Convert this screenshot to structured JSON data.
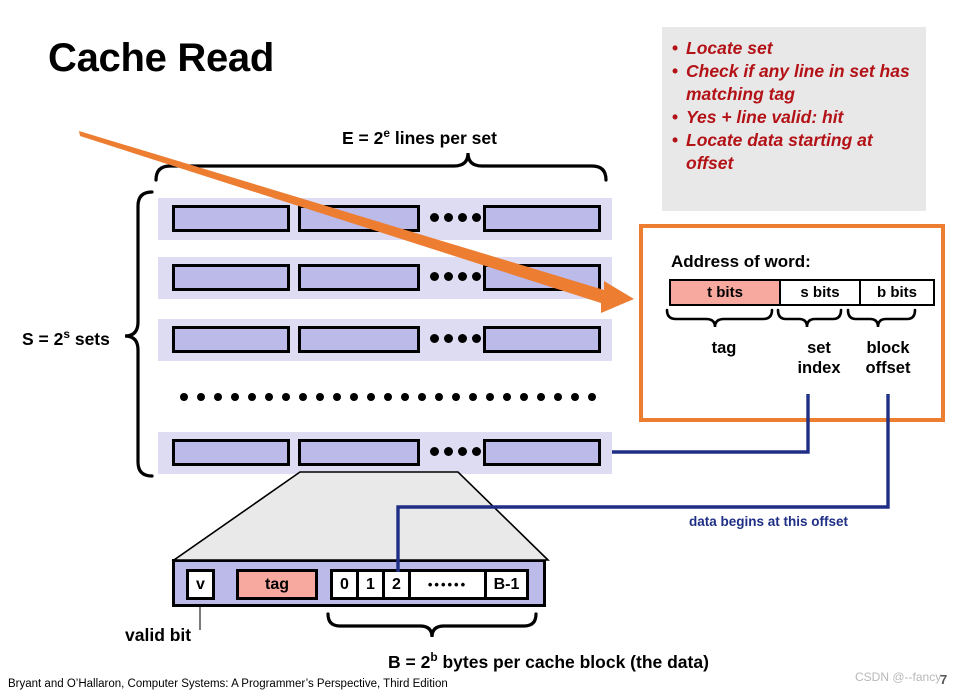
{
  "title": "Cache Read",
  "bullets": [
    "Locate set",
    "Check if any line in set has matching tag",
    "Yes + line valid: hit",
    "Locate data starting at offset"
  ],
  "labels": {
    "lines_per_set_pre": "E = 2",
    "lines_per_set_sup": "e",
    "lines_per_set_post": " lines per set",
    "sets_pre": "S = 2",
    "sets_sup": "s",
    "sets_post": " sets",
    "valid_bit": "valid bit",
    "block_size_pre": "B = 2",
    "block_size_sup": "b",
    "block_size_post": " bytes per cache block (the data)",
    "offset_note": "data begins at this offset"
  },
  "address": {
    "title": "Address of word:",
    "segments": [
      {
        "label": "t bits",
        "name": "tag-bits"
      },
      {
        "label": "s bits",
        "name": "set-bits"
      },
      {
        "label": "b bits",
        "name": "block-bits"
      }
    ],
    "captions": {
      "tag": "tag",
      "set_index": "set index",
      "block_offset": "block offset"
    }
  },
  "cache_line": {
    "valid": "v",
    "tag": "tag",
    "bytes": [
      "0",
      "1",
      "2",
      "••••••",
      "B-1"
    ]
  },
  "footer": "Bryant and O’Hallaron, Computer Systems: A Programmer’s Perspective, Third Edition",
  "watermark": "CSDN @--fancy",
  "page_number": "7",
  "colors": {
    "accent_orange": "#ed7d31",
    "bullet_red": "#b31217",
    "connector_blue": "#1f2f86",
    "line_fill": "#bcbae8",
    "set_bg": "#dedcf2",
    "tag_pink": "#f8a99f",
    "callout_bg": "#e8e8e8",
    "trapezoid_fill": "#e9e9e9"
  }
}
